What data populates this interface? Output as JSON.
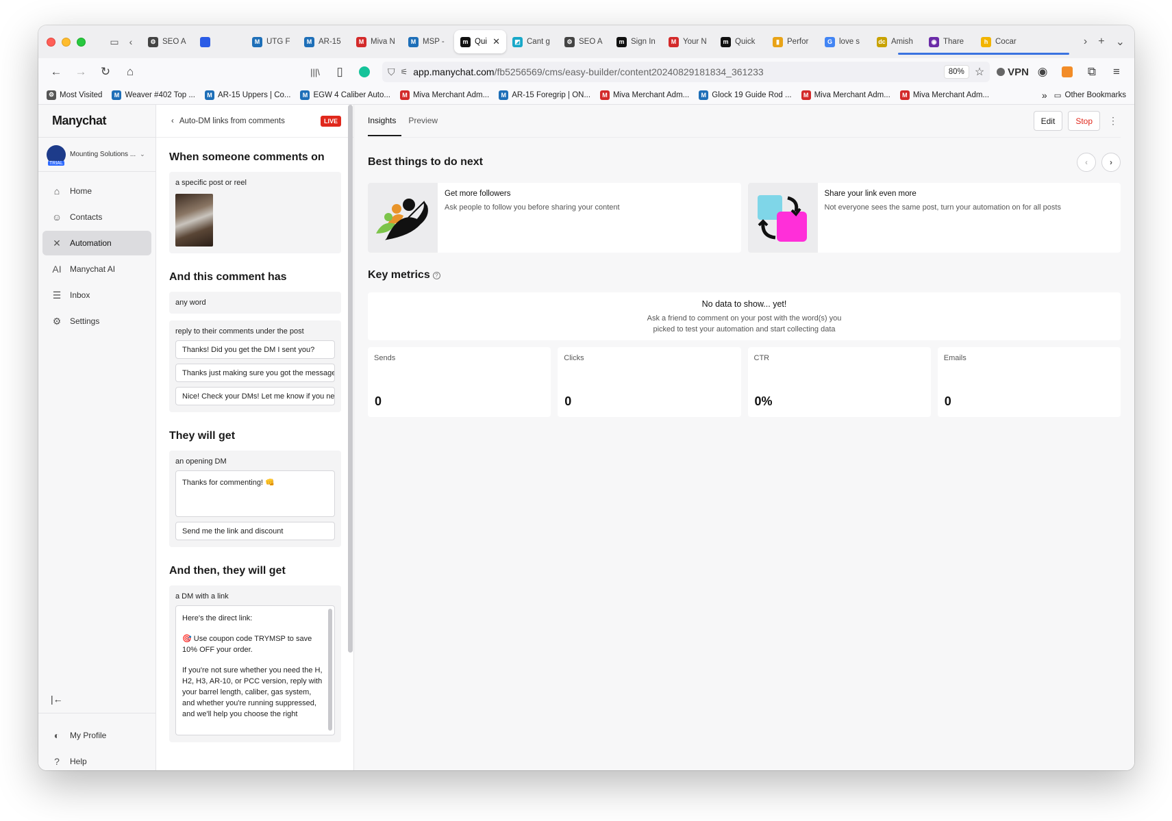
{
  "browser": {
    "tabs": [
      {
        "label": "SEO A",
        "color": "#444444",
        "glyph": "⚙"
      },
      {
        "label": "",
        "color": "#2b5ce6",
        "glyph": ""
      },
      {
        "label": "UTG F",
        "color": "#1e6fb8",
        "glyph": "M"
      },
      {
        "label": "AR-15",
        "color": "#1e6fb8",
        "glyph": "M"
      },
      {
        "label": "Miva N",
        "color": "#d32a2a",
        "glyph": "M"
      },
      {
        "label": "MSP -",
        "color": "#1e6fb8",
        "glyph": "M"
      },
      {
        "label": "Qui",
        "color": "#111111",
        "glyph": "m",
        "active": true
      },
      {
        "label": "Cant g",
        "color": "#18a8c8",
        "glyph": "◩"
      },
      {
        "label": "SEO A",
        "color": "#444444",
        "glyph": "⚙"
      },
      {
        "label": "Sign In",
        "color": "#111111",
        "glyph": "m"
      },
      {
        "label": "Your N",
        "color": "#d32a2a",
        "glyph": "M"
      },
      {
        "label": "Quick",
        "color": "#111111",
        "glyph": "m"
      },
      {
        "label": "Perfor",
        "color": "#e8a317",
        "glyph": "▮"
      },
      {
        "label": "love s",
        "color": "#4285f4",
        "glyph": "G"
      },
      {
        "label": "Amish",
        "color": "#c8a200",
        "glyph": "dc"
      },
      {
        "label": "Thare",
        "color": "#6b2ca8",
        "glyph": "◉"
      },
      {
        "label": "Cocar",
        "color": "#f2b400",
        "glyph": "h"
      }
    ],
    "url_domain": "app.manychat.com",
    "url_path": "/fb5256569/cms/easy-builder/content20240829181834_361233",
    "zoom": "80%",
    "vpn_label": "VPN",
    "bookmarks": [
      {
        "label": "Most Visited",
        "color": "#555555",
        "glyph": "⚙"
      },
      {
        "label": "Weaver #402 Top ...",
        "color": "#1e6fb8",
        "glyph": "M"
      },
      {
        "label": "AR-15 Uppers | Co...",
        "color": "#1e6fb8",
        "glyph": "M"
      },
      {
        "label": "EGW 4 Caliber Auto...",
        "color": "#1e6fb8",
        "glyph": "M"
      },
      {
        "label": "Miva Merchant Adm...",
        "color": "#d32a2a",
        "glyph": "M"
      },
      {
        "label": "AR-15 Foregrip | ON...",
        "color": "#1e6fb8",
        "glyph": "M"
      },
      {
        "label": "Miva Merchant Adm...",
        "color": "#d32a2a",
        "glyph": "M"
      },
      {
        "label": "Glock 19 Guide Rod ...",
        "color": "#1e6fb8",
        "glyph": "M"
      },
      {
        "label": "Miva Merchant Adm...",
        "color": "#d32a2a",
        "glyph": "M"
      },
      {
        "label": "Miva Merchant Adm...",
        "color": "#d32a2a",
        "glyph": "M"
      }
    ],
    "other_bookmarks": "Other Bookmarks"
  },
  "sidebar": {
    "logo": "Manychat",
    "account_name": "Mounting Solutions ...",
    "account_badge": "TRIAL",
    "items": [
      {
        "label": "Home",
        "icon": "⌂"
      },
      {
        "label": "Contacts",
        "icon": "☺"
      },
      {
        "label": "Automation",
        "icon": "✕",
        "active": true
      },
      {
        "label": "Manychat AI",
        "icon": "AI"
      },
      {
        "label": "Inbox",
        "icon": "☰"
      },
      {
        "label": "Settings",
        "icon": "⚙"
      }
    ],
    "bottom": [
      {
        "label": "My Profile",
        "icon": "◐"
      },
      {
        "label": "Help",
        "icon": "?"
      }
    ]
  },
  "flow": {
    "title": "Auto-DM links from comments",
    "status": "LIVE",
    "sec1": {
      "title": "When someone comments on",
      "target": "a specific post or reel"
    },
    "sec2": {
      "title": "And this comment has",
      "keyword": "any word",
      "reply_label": "reply to their comments under the post",
      "replies": [
        "Thanks! Did you get the DM I sent you?",
        "Thanks just making sure you got the message",
        "Nice! Check your DMs! Let me know if you need"
      ]
    },
    "sec3": {
      "title": "They will get",
      "label": "an opening DM",
      "message": "Thanks for commenting! 👊",
      "button": "Send me the link and discount"
    },
    "sec4": {
      "title": "And then, they will get",
      "label": "a DM with a link",
      "p1": "Here's the direct link:",
      "p2": "🎯 Use coupon code TRYMSP to save 10% OFF your order.",
      "p3": "If you're not sure whether you need the H, H2, H3, AR-10, or PCC version, reply with your barrel length, caliber, gas system, and whether you're running suppressed, and we'll help you choose the right"
    }
  },
  "main": {
    "tabs": [
      "Insights",
      "Preview"
    ],
    "edit_label": "Edit",
    "stop_label": "Stop",
    "best_title": "Best things to do next",
    "tips": [
      {
        "title": "Get more followers",
        "sub": "Ask people to follow you before sharing your content"
      },
      {
        "title": "Share your link even more",
        "sub": "Not everyone sees the same post, turn your automation on for all posts"
      }
    ],
    "metrics_title": "Key metrics",
    "empty_title": "No data to show... yet!",
    "empty_line1": "Ask a friend to comment on your post with the word(s) you",
    "empty_line2": "picked to test your automation and start collecting data",
    "metrics": [
      {
        "label": "Sends",
        "value": "0"
      },
      {
        "label": "Clicks",
        "value": "0"
      },
      {
        "label": "CTR",
        "value": "0%"
      },
      {
        "label": "Emails",
        "value": "0"
      }
    ]
  }
}
